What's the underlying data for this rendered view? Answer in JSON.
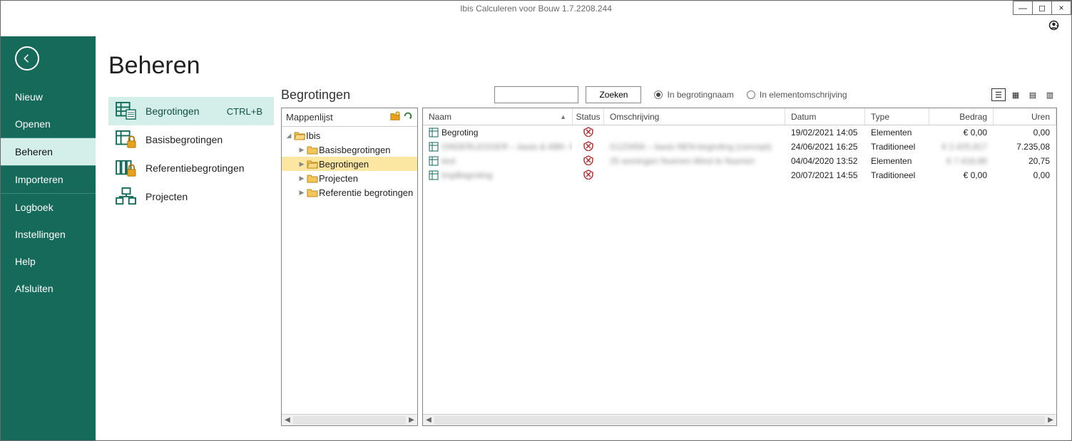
{
  "window": {
    "title": "Ibis Calculeren voor Bouw 1.7.2208.244",
    "controls": {
      "minimize": "—",
      "maximize": "◻",
      "close": "×"
    }
  },
  "sidebar": {
    "back_icon": "arrow-left",
    "items": [
      {
        "label": "Nieuw"
      },
      {
        "label": "Openen"
      },
      {
        "label": "Beheren",
        "active": true
      },
      {
        "label": "Importeren"
      },
      {
        "label": "Logboek"
      },
      {
        "label": "Instellingen"
      },
      {
        "label": "Help"
      },
      {
        "label": "Afsluiten"
      }
    ]
  },
  "page": {
    "title": "Beheren",
    "subnav": [
      {
        "label": "Begrotingen",
        "shortcut": "CTRL+B",
        "active": true,
        "icon": "grid-doc"
      },
      {
        "label": "Basisbegrotingen",
        "icon": "grid-lock"
      },
      {
        "label": "Referentiebegrotingen",
        "icon": "books-lock"
      },
      {
        "label": "Projecten",
        "icon": "project-tree"
      }
    ]
  },
  "content": {
    "heading": "Begrotingen",
    "search": {
      "value": "",
      "button": "Zoeken"
    },
    "radios": {
      "options": [
        {
          "label": "In begrotingnaam",
          "selected": true
        },
        {
          "label": "In elementomschrijving",
          "selected": false
        }
      ]
    },
    "views": [
      "list",
      "medium",
      "large",
      "tiles"
    ]
  },
  "tree": {
    "header": "Mappenlijst",
    "header_icons": [
      "new-folder",
      "refresh"
    ],
    "root": {
      "label": "Ibis",
      "expanded": true,
      "children": [
        {
          "label": "Basisbegrotingen"
        },
        {
          "label": "Begrotingen",
          "selected": true
        },
        {
          "label": "Projecten"
        },
        {
          "label": "Referentie begrotingen"
        }
      ]
    }
  },
  "grid": {
    "columns": [
      {
        "key": "naam",
        "label": "Naam",
        "sort": "asc"
      },
      {
        "key": "status",
        "label": "Status"
      },
      {
        "key": "omschrijving",
        "label": "Omschrijving"
      },
      {
        "key": "datum",
        "label": "Datum"
      },
      {
        "key": "type",
        "label": "Type"
      },
      {
        "key": "bedrag",
        "label": "Bedrag"
      },
      {
        "key": "uren",
        "label": "Uren"
      }
    ],
    "rows": [
      {
        "naam": "Begroting",
        "status": "locked",
        "omschrijving": "",
        "datum": "19/02/2021 14:05",
        "type": "Elementen",
        "bedrag": "€ 0,00",
        "uren": "0,00"
      },
      {
        "naam": "ONDERLEGGER – basis & ABK- NE…",
        "status": "locked",
        "omschrijving": "G123456 – basis NEN-begroting (concept)",
        "datum": "24/06/2021 16:25",
        "type": "Traditioneel",
        "bedrag": "€ 2.425,917",
        "uren": "7.235,08",
        "blur": true
      },
      {
        "naam": "test",
        "status": "locked",
        "omschrijving": "25 woningen Nuenen-West te Nuenen",
        "datum": "04/04/2020 13:52",
        "type": "Elementen",
        "bedrag": "€ 7.418,86",
        "uren": "20,75",
        "blur": true
      },
      {
        "naam": "tmpBegroting",
        "status": "locked",
        "omschrijving": "",
        "datum": "20/07/2021 14:55",
        "type": "Traditioneel",
        "bedrag": "€ 0,00",
        "uren": "0,00",
        "blur_name": true
      }
    ]
  }
}
